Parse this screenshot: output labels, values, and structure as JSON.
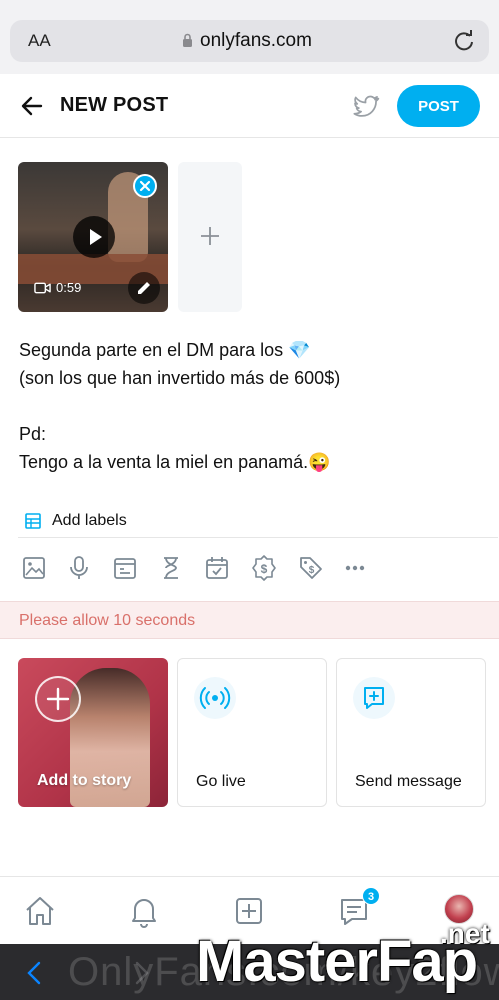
{
  "browser": {
    "text_size_label": "AA",
    "url": "onlyfans.com"
  },
  "header": {
    "title": "NEW POST",
    "post_label": "POST"
  },
  "media": {
    "duration": "0:59"
  },
  "post": {
    "text": "Segunda parte en el DM para los 💎\n(son los que han invertido más de 600$)\n\nPd:\nTengo a la venta la miel en panamá.😜"
  },
  "labels": {
    "add_label": "Add labels"
  },
  "toolbar": {
    "icons": [
      "image-icon",
      "microphone-icon",
      "poll-icon",
      "hourglass-icon",
      "calendar-icon",
      "price-icon",
      "tag-icon",
      "more-icon"
    ]
  },
  "notice": {
    "text": "Please allow 10 seconds"
  },
  "cards": {
    "story_label": "Add to story",
    "live_label": "Go live",
    "message_label": "Send message"
  },
  "bottom_nav": {
    "messages_badge": "3"
  },
  "watermark": {
    "url_text": "OnlyFans.com/key2flow",
    "brand": "MasterFap",
    "brand_suffix": ".net"
  },
  "colors": {
    "accent": "#00aff0",
    "notice_text": "#d9706a",
    "notice_bg": "#fbeeee"
  }
}
